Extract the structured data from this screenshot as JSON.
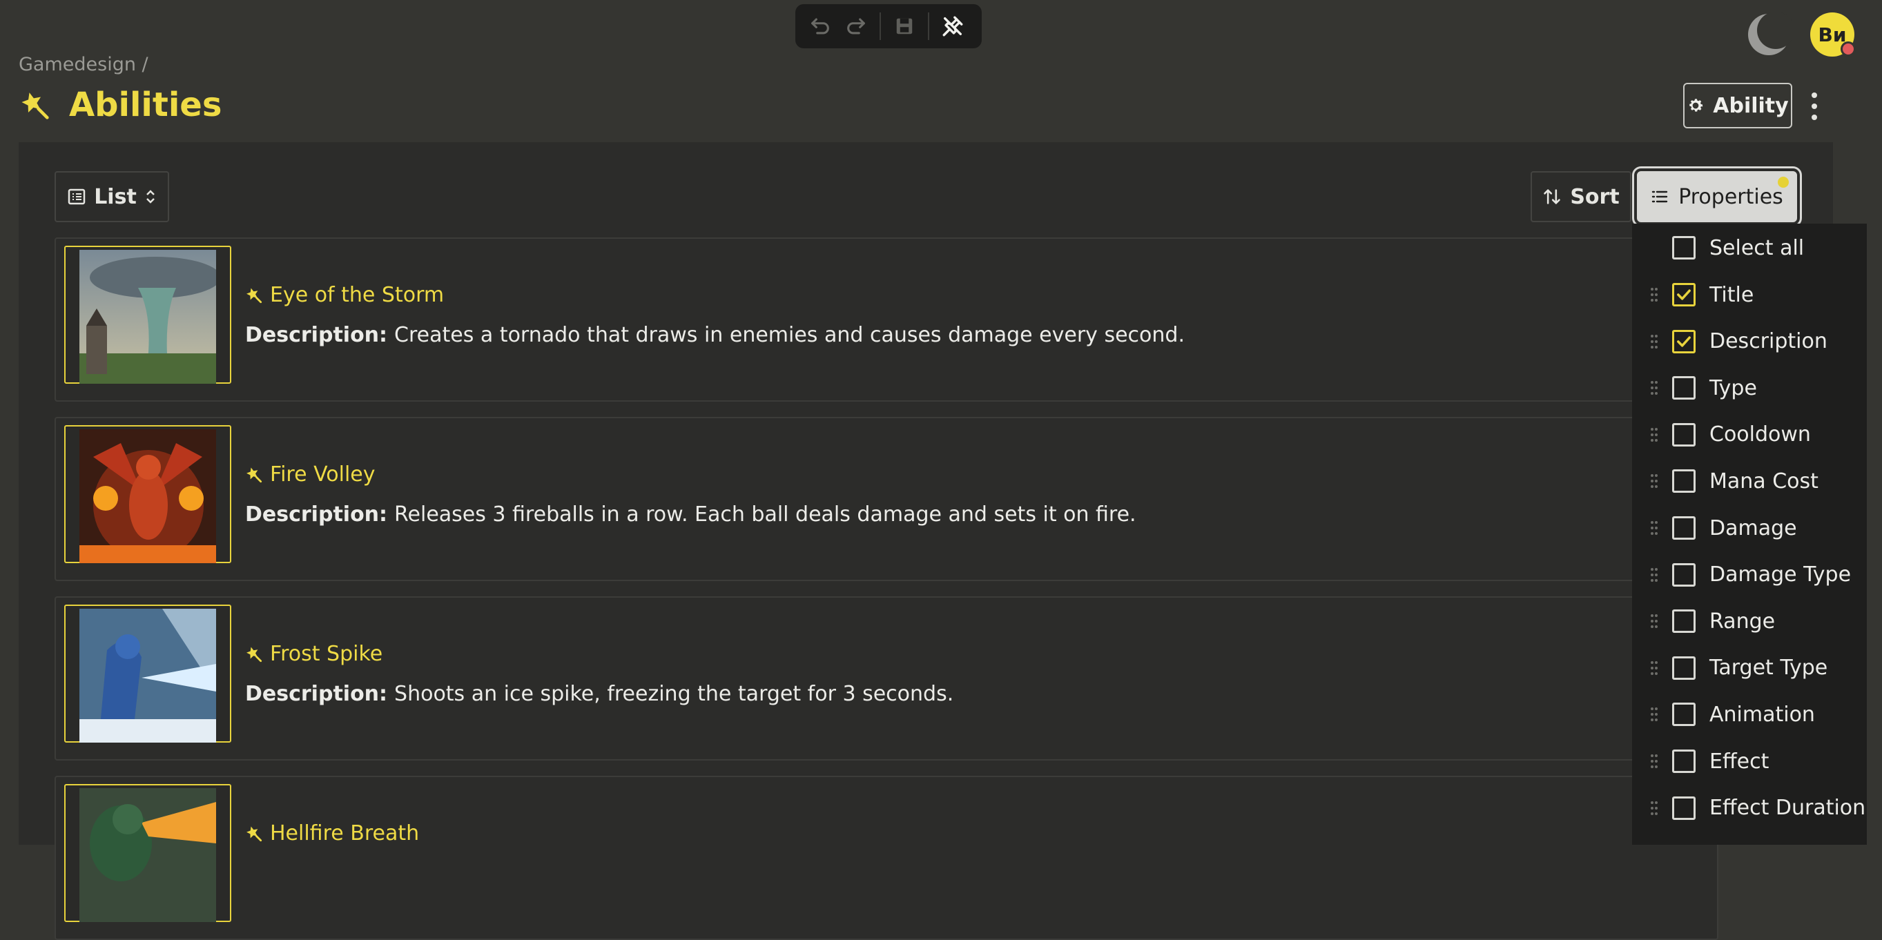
{
  "toolbar": {
    "icons": [
      "undo-icon",
      "redo-icon",
      "save-icon",
      "pin-icon"
    ]
  },
  "header": {
    "breadcrumb": "Gamedesign /",
    "title": "Abilities",
    "ability_button": "Ability",
    "avatar_initials": "Ви"
  },
  "controls": {
    "view_label": "List",
    "sort_label": "Sort",
    "properties_label": "Properties"
  },
  "description_label": "Description:",
  "cards": [
    {
      "title": "Eye of the Storm",
      "description": "Creates a tornado that draws in enemies and causes damage every second."
    },
    {
      "title": "Fire Volley",
      "description": "Releases 3 fireballs in a row. Each ball deals damage and sets it on fire."
    },
    {
      "title": "Frost Spike",
      "description": "Shoots an ice spike, freezing the target for 3 seconds."
    },
    {
      "title": "Hellfire Breath",
      "description": ""
    }
  ],
  "properties_menu": {
    "select_all": "Select all",
    "items": [
      {
        "label": "Title",
        "checked": true
      },
      {
        "label": "Description",
        "checked": true
      },
      {
        "label": "Type",
        "checked": false
      },
      {
        "label": "Cooldown",
        "checked": false
      },
      {
        "label": "Mana Cost",
        "checked": false
      },
      {
        "label": "Damage",
        "checked": false
      },
      {
        "label": "Damage Type",
        "checked": false
      },
      {
        "label": "Range",
        "checked": false
      },
      {
        "label": "Target Type",
        "checked": false
      },
      {
        "label": "Animation",
        "checked": false
      },
      {
        "label": "Effect",
        "checked": false
      },
      {
        "label": "Effect Duration",
        "checked": false
      }
    ]
  },
  "colors": {
    "accent": "#efdb45",
    "background": "#353531",
    "panel": "#2c2c2a"
  }
}
